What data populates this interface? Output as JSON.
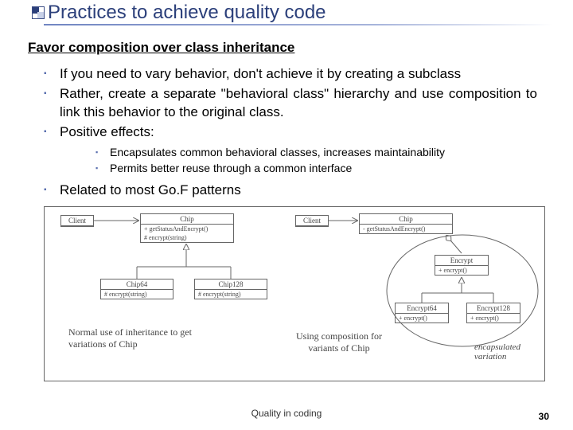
{
  "header": {
    "title": "Practices to achieve quality code"
  },
  "subtitle": "Favor composition over class inheritance",
  "bul": {
    "i1": "If you need to vary behavior, don't achieve it by creating a subclass",
    "i2": "Rather, create a separate \"behavioral class\" hierarchy and use composition to link this behavior to the original class.",
    "i3": "Positive effects:",
    "s1": "Encapsulates common behavioral classes, increases maintainability",
    "s2": "Permits better reuse through a common interface",
    "i4": "Related to most Go.F patterns"
  },
  "dg": {
    "left": {
      "client": "Client",
      "chip": "Chip",
      "chip_m1": "+ getStatusAndEncrypt()",
      "chip_m2": "# encrypt(string)",
      "c64": "Chip64",
      "c64_m": "# encrypt(string)",
      "c128": "Chip128",
      "c128_m": "# encrypt(string)",
      "cap": "Normal use of inheritance to get variations of Chip"
    },
    "right": {
      "client": "Client",
      "chip": "Chip",
      "chip_m": "- getStatusAndEncrypt()",
      "enc": "Encrypt",
      "enc_m": "+ encrypt()",
      "e64": "Encrypt64",
      "e64_m": "+ encrypt()",
      "e128": "Encrypt128",
      "e128_m": "+ encrypt()",
      "cap": "Using composition for variants of Chip",
      "encv": "encapsulated variation"
    }
  },
  "footer": {
    "center": "Quality in coding",
    "page": "30"
  }
}
